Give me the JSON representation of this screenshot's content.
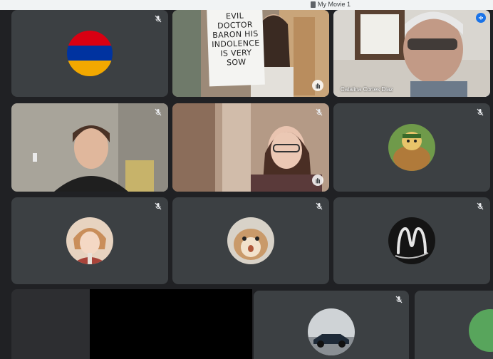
{
  "window": {
    "title": "My Movie 1"
  },
  "tiles": [
    {
      "id": "flag",
      "avatar": "armenia-flag-avatar",
      "muted": true
    },
    {
      "id": "sign-girl",
      "video": true,
      "sign_lines": [
        "EVIL DOCTOR",
        "BARON HIS",
        "INDOLENCE",
        "IS VERY",
        "SOW"
      ],
      "hand_raised": true
    },
    {
      "id": "catalina",
      "video": true,
      "name": "Catalina Cortes Diaz",
      "speaking": true
    },
    {
      "id": "boy",
      "video": true,
      "muted": true
    },
    {
      "id": "glasses-girl",
      "video": true,
      "muted": true,
      "hand_raised": true
    },
    {
      "id": "cartoon",
      "avatar": "cartoon-character-avatar",
      "muted": true
    },
    {
      "id": "anime",
      "avatar": "anime-character-avatar",
      "muted": true
    },
    {
      "id": "hamster",
      "avatar": "hamster-avatar",
      "muted": true
    },
    {
      "id": "letter-m",
      "avatar": "letter-m-avatar",
      "muted": true
    },
    {
      "id": "car",
      "avatar": "race-car-avatar",
      "muted": true
    },
    {
      "id": "partial-right",
      "muted": false
    }
  ],
  "colors": {
    "background": "#202124",
    "tile": "#3c4043",
    "accent": "#8ab4f8",
    "speaking": "#1a73e8",
    "fab": "#58a55c"
  },
  "icons": {
    "mic_off": "mic-off-icon",
    "hand": "raised-hand-icon",
    "speaking": "audio-level-icon"
  }
}
